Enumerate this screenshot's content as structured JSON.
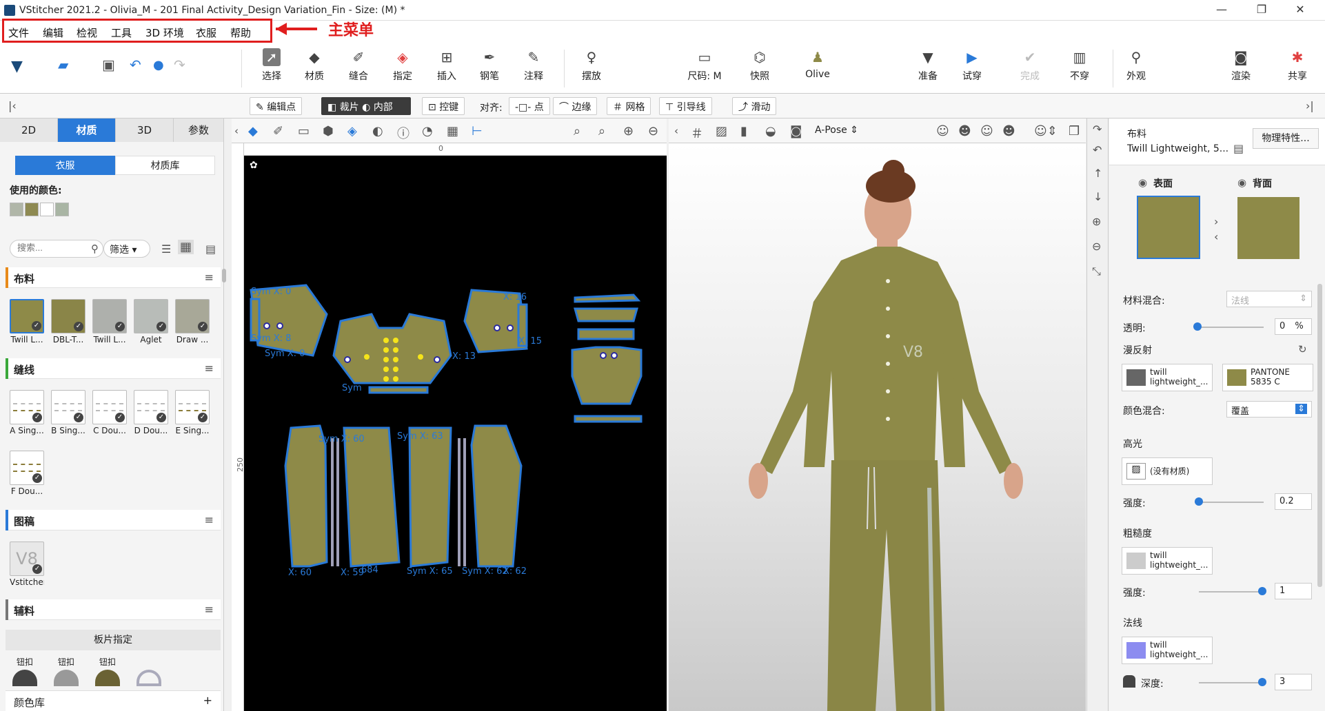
{
  "window": {
    "title": "VStitcher 2021.2 - Olivia_M - 201 Final Activity_Design Variation_Fin - Size: (M) *",
    "minimize": "—",
    "maximize": "❐",
    "close": "✕"
  },
  "menu": {
    "items": [
      "文件",
      "编辑",
      "检视",
      "工具",
      "3D 环境",
      "衣服",
      "帮助"
    ],
    "annotation_label": "主菜单"
  },
  "toolbar": {
    "tools": [
      {
        "label": "选择",
        "icon": "select-arrow-icon"
      },
      {
        "label": "材质",
        "icon": "material-icon"
      },
      {
        "label": "缝合",
        "icon": "stitch-icon"
      },
      {
        "label": "指定",
        "icon": "assign-icon"
      },
      {
        "label": "插入",
        "icon": "insert-icon"
      },
      {
        "label": "钢笔",
        "icon": "pen-icon"
      },
      {
        "label": "注释",
        "icon": "annotation-icon"
      },
      {
        "label": "摆放",
        "icon": "pose-icon"
      },
      {
        "label": "尺码: M",
        "icon": "size-icon"
      },
      {
        "label": "快照",
        "icon": "snapshot-icon"
      },
      {
        "label": "Olive",
        "icon": "colorway-icon"
      },
      {
        "label": "准备",
        "icon": "prepare-icon"
      },
      {
        "label": "试穿",
        "icon": "play-icon"
      },
      {
        "label": "完成",
        "icon": "done-icon"
      },
      {
        "label": "不穿",
        "icon": "undress-icon"
      },
      {
        "label": "外观",
        "icon": "appearance-icon"
      },
      {
        "label": "渲染",
        "icon": "camera-icon"
      },
      {
        "label": "共享",
        "icon": "share-icon"
      }
    ]
  },
  "subtoolbar": {
    "edit_points": "编辑点",
    "cut": "裁片",
    "inner": "内部",
    "control": "控键",
    "align": "对齐:",
    "point": "点",
    "edge": "边缘",
    "grid": "网格",
    "guideline": "引导线",
    "slide": "滑动"
  },
  "left": {
    "tabs": [
      "2D",
      "材质",
      "3D",
      "参数"
    ],
    "subtabs": [
      "衣服",
      "材质库"
    ],
    "used_colors_label": "使用的颜色:",
    "used_colors": [
      "#b0b6a8",
      "#8e8a52",
      "#ffffff",
      "#a9b5a4"
    ],
    "search_placeholder": "搜索...",
    "filter_label": "筛选",
    "sections": {
      "fabric": "布料",
      "seam": "缝线",
      "artwork": "图稿",
      "trims": "辅料",
      "colors": "颜色库"
    },
    "fabrics": [
      {
        "label": "Twill L...",
        "color": "#8e8a48"
      },
      {
        "label": "DBL-T...",
        "color": "#8a8548"
      },
      {
        "label": "Twill L...",
        "color": "#aeb0ac"
      },
      {
        "label": "Aglet",
        "color": "#b8bcb8"
      },
      {
        "label": "Draw ...",
        "color": "#a8a898"
      }
    ],
    "seams": [
      "A Sing...",
      "B Sing...",
      "C Dou...",
      "D Dou...",
      "E Sing...",
      "F Dou..."
    ],
    "artwork": [
      "Vstitcher"
    ],
    "trim_assign": "板片指定",
    "trims": [
      "钮扣",
      "钮扣",
      "钮扣"
    ],
    "add": "+"
  },
  "pattern": {
    "ruler_top": "0",
    "ruler_left": "250",
    "labels": [
      "Sym X: 0",
      "Sym X: 8",
      "Sym X: 0",
      "X: 16",
      "X: 15",
      "Sym",
      "X: 13",
      "Sym X: 60",
      "X: 59",
      "684",
      "Sym X: 63",
      "Sym X: 62",
      "X: 60",
      "Sym X: 65",
      "X: 62"
    ]
  },
  "view3d": {
    "pose": "A-Pose"
  },
  "right": {
    "fabric_label": "布料",
    "fabric_name": "Twill Lightweight, 5...",
    "physics_button": "物理特性...",
    "front": "表面",
    "back": "背面",
    "material_mix_label": "材料混合:",
    "material_mix_value": "法线",
    "opacity_label": "透明:",
    "opacity_value": "0",
    "opacity_unit": "%",
    "diffuse_label": "漫反射",
    "diffuse_map": "twill lightweight_...",
    "pantone": "PANTONE 5835 C",
    "color_mix_label": "颜色混合:",
    "color_mix_value": "覆盖",
    "specular_label": "高光",
    "specular_map": "(没有材质)",
    "specular_strength_label": "强度:",
    "specular_strength": "0.2",
    "roughness_label": "粗糙度",
    "roughness_map": "twill lightweight_...",
    "roughness_strength_label": "强度:",
    "roughness_strength": "1",
    "normal_label": "法线",
    "normal_map": "twill lightweight_...",
    "depth_label": "深度:",
    "depth_value": "3"
  },
  "colors": {
    "accent": "#2a7ad8",
    "fabric": "#8e8a48",
    "annotation": "#e01e1e"
  }
}
